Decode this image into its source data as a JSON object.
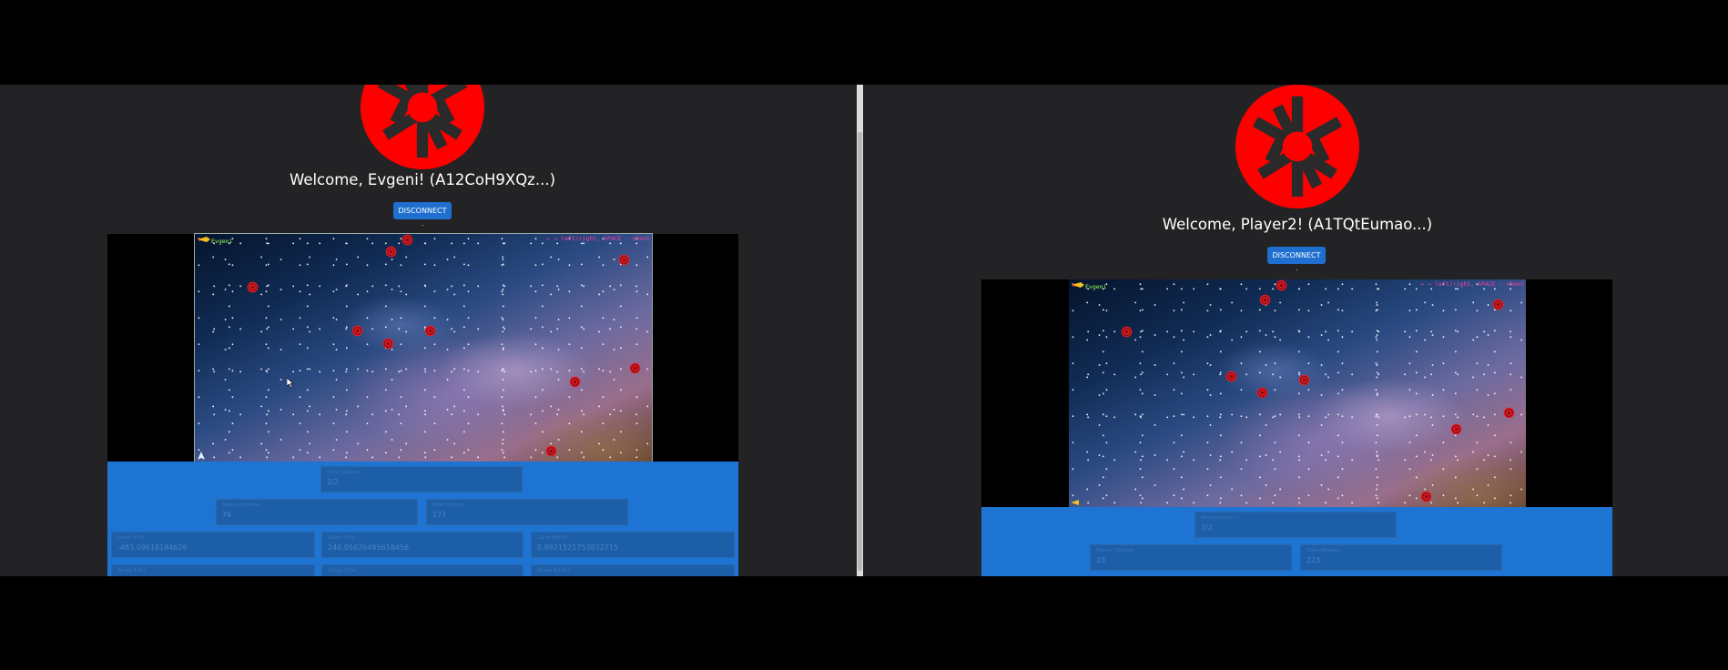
{
  "colors": {
    "background": "#232325",
    "accent": "#1e6fd0",
    "stats_panel": "#1e74d2",
    "logo_red": "#ff0000",
    "target_red": "#e01c24"
  },
  "left": {
    "welcome": "Welcome, Evgeni! (A12CoH9XQz...)",
    "disconnect_label": "DISCONNECT",
    "game": {
      "controls_hint": "← → left/right, SPACE - shoot",
      "player_label": "Evgeni"
    },
    "stats": {
      "active_players": {
        "label": "Active players",
        "value": "2/2"
      },
      "tokens_collected": {
        "label": "Tokens Collected",
        "value": "76"
      },
      "token_balance": {
        "label": "Token Balance",
        "value": "277"
      },
      "game_x_pos": {
        "label": "Game X Pos",
        "value": "-483.09618184626"
      },
      "game_y_pos": {
        "label": "Game Y Pos",
        "value": "246.05626485618456"
      },
      "game_rot_pos": {
        "label": "Game Rot Pos",
        "value": "0.8921521753832715"
      },
      "row4": [
        "Wrapp X Pos",
        "Wrapp Y Pos",
        "Wrapp Rot Pos"
      ]
    }
  },
  "right": {
    "welcome": "Welcome, Player2! (A1TQtEumao...)",
    "disconnect_label": "DISCONNECT",
    "game": {
      "controls_hint": "← → left/right, SPACE - shoot",
      "player_label": "Evgeni"
    },
    "stats": {
      "active_players": {
        "label": "Active players",
        "value": "2/2"
      },
      "tokens_collected": {
        "label": "Tokens Collected",
        "value": "33"
      },
      "token_balance": {
        "label": "Token Balance",
        "value": "223"
      }
    }
  }
}
